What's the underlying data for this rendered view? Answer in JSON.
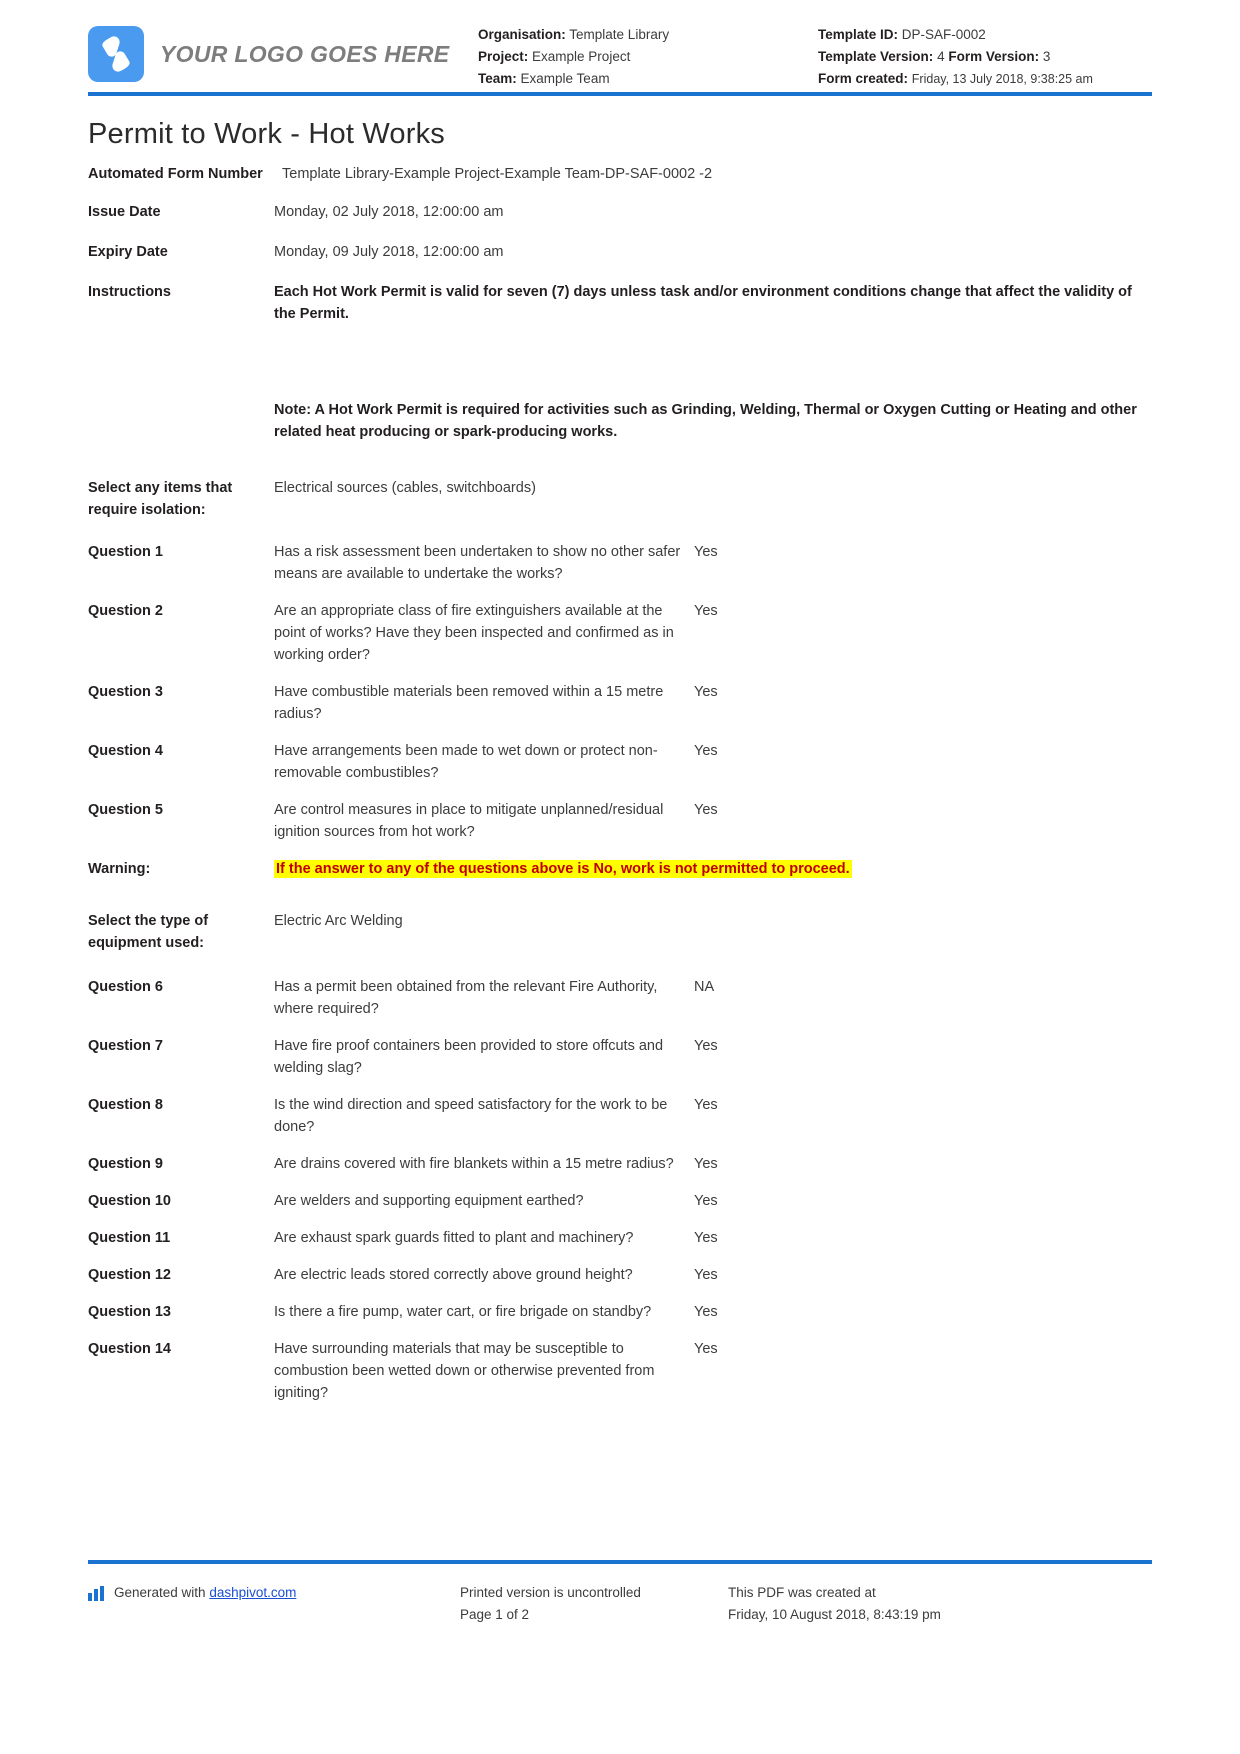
{
  "header": {
    "logo_text": "YOUR LOGO GOES HERE",
    "left_meta": [
      {
        "label": "Organisation:",
        "value": "Template Library"
      },
      {
        "label": "Project:",
        "value": "Example Project"
      },
      {
        "label": "Team:",
        "value": "Example Team"
      }
    ],
    "right_meta": {
      "template_id_label": "Template ID:",
      "template_id_value": "DP-SAF-0002",
      "template_version_label": "Template Version:",
      "template_version_value": "4",
      "form_version_label": "Form Version:",
      "form_version_value": "3",
      "form_created_label": "Form created:",
      "form_created_value": "Friday, 13 July 2018, 9:38:25 am"
    }
  },
  "title": "Permit to Work - Hot Works",
  "fields": {
    "automated_form_number_label": "Automated Form Number",
    "automated_form_number_value": "Template Library-Example Project-Example Team-DP-SAF-0002   -2",
    "issue_date_label": "Issue Date",
    "issue_date_value": "Monday, 02 July 2018, 12:00:00 am",
    "expiry_date_label": "Expiry Date",
    "expiry_date_value": "Monday, 09 July 2018, 12:00:00 am",
    "instructions_label": "Instructions",
    "instructions_value": "Each Hot Work Permit is valid for seven (7) days unless task and/or environment conditions change that affect the validity of the Permit.",
    "instructions_note": "Note: A Hot Work Permit is required for activities such as Grinding, Welding, Thermal or Oxygen Cutting or Heating and other related heat producing or spark-producing works.",
    "isolation_label": "Select any items that require isolation:",
    "isolation_value": "Electrical sources (cables, switchboards)",
    "warning_label": "Warning:",
    "warning_value": "If the answer to any of the questions above is No, work is not permitted to proceed.",
    "equipment_label": "Select the type of equipment used:",
    "equipment_value": "Electric Arc Welding"
  },
  "questions_group_1": [
    {
      "label": "Question 1",
      "text": "Has a risk assessment been undertaken to show no other safer means are available to undertake the works?",
      "answer": "Yes"
    },
    {
      "label": "Question 2",
      "text": "Are an appropriate class of fire extinguishers available at the point of works? Have they been inspected and confirmed as in working order?",
      "answer": "Yes"
    },
    {
      "label": "Question 3",
      "text": "Have combustible materials been removed within a 15 metre radius?",
      "answer": "Yes"
    },
    {
      "label": "Question 4",
      "text": "Have arrangements been made to wet down or protect non-removable combustibles?",
      "answer": "Yes"
    },
    {
      "label": "Question 5",
      "text": "Are control measures in place to mitigate unplanned/residual ignition sources from hot work?",
      "answer": "Yes"
    }
  ],
  "questions_group_2": [
    {
      "label": "Question 6",
      "text": "Has a permit been obtained from the relevant Fire Authority, where required?",
      "answer": "NA"
    },
    {
      "label": "Question 7",
      "text": "Have fire proof containers been provided to store offcuts and welding slag?",
      "answer": "Yes"
    },
    {
      "label": "Question 8",
      "text": "Is the wind direction and speed satisfactory for the work to be done?",
      "answer": "Yes"
    },
    {
      "label": "Question 9",
      "text": "Are drains covered with fire blankets within a 15 metre radius?",
      "answer": "Yes"
    },
    {
      "label": "Question 10",
      "text": "Are welders and supporting equipment earthed?",
      "answer": "Yes"
    },
    {
      "label": "Question 11",
      "text": "Are exhaust spark guards fitted to plant and machinery?",
      "answer": "Yes"
    },
    {
      "label": "Question 12",
      "text": "Are electric leads stored correctly above ground height?",
      "answer": "Yes"
    },
    {
      "label": "Question 13",
      "text": "Is there a fire pump, water cart, or fire brigade on standby?",
      "answer": "Yes"
    },
    {
      "label": "Question 14",
      "text": "Have surrounding materials that may be susceptible to combustion been wetted down or otherwise prevented from igniting?",
      "answer": "Yes"
    }
  ],
  "footer": {
    "generated_prefix": "Generated with ",
    "generated_link": "dashpivot.com",
    "printed_notice": "Printed version is uncontrolled",
    "page_number": "Page 1 of 2",
    "pdf_created_label": "This PDF was created at",
    "pdf_created_value": "Friday, 10 August 2018, 8:43:19 pm"
  },
  "colors": {
    "accent_blue": "#1a73d0",
    "logo_blue": "#4a9bf0",
    "highlight_yellow": "#ffff00",
    "warning_red": "#c00000"
  }
}
